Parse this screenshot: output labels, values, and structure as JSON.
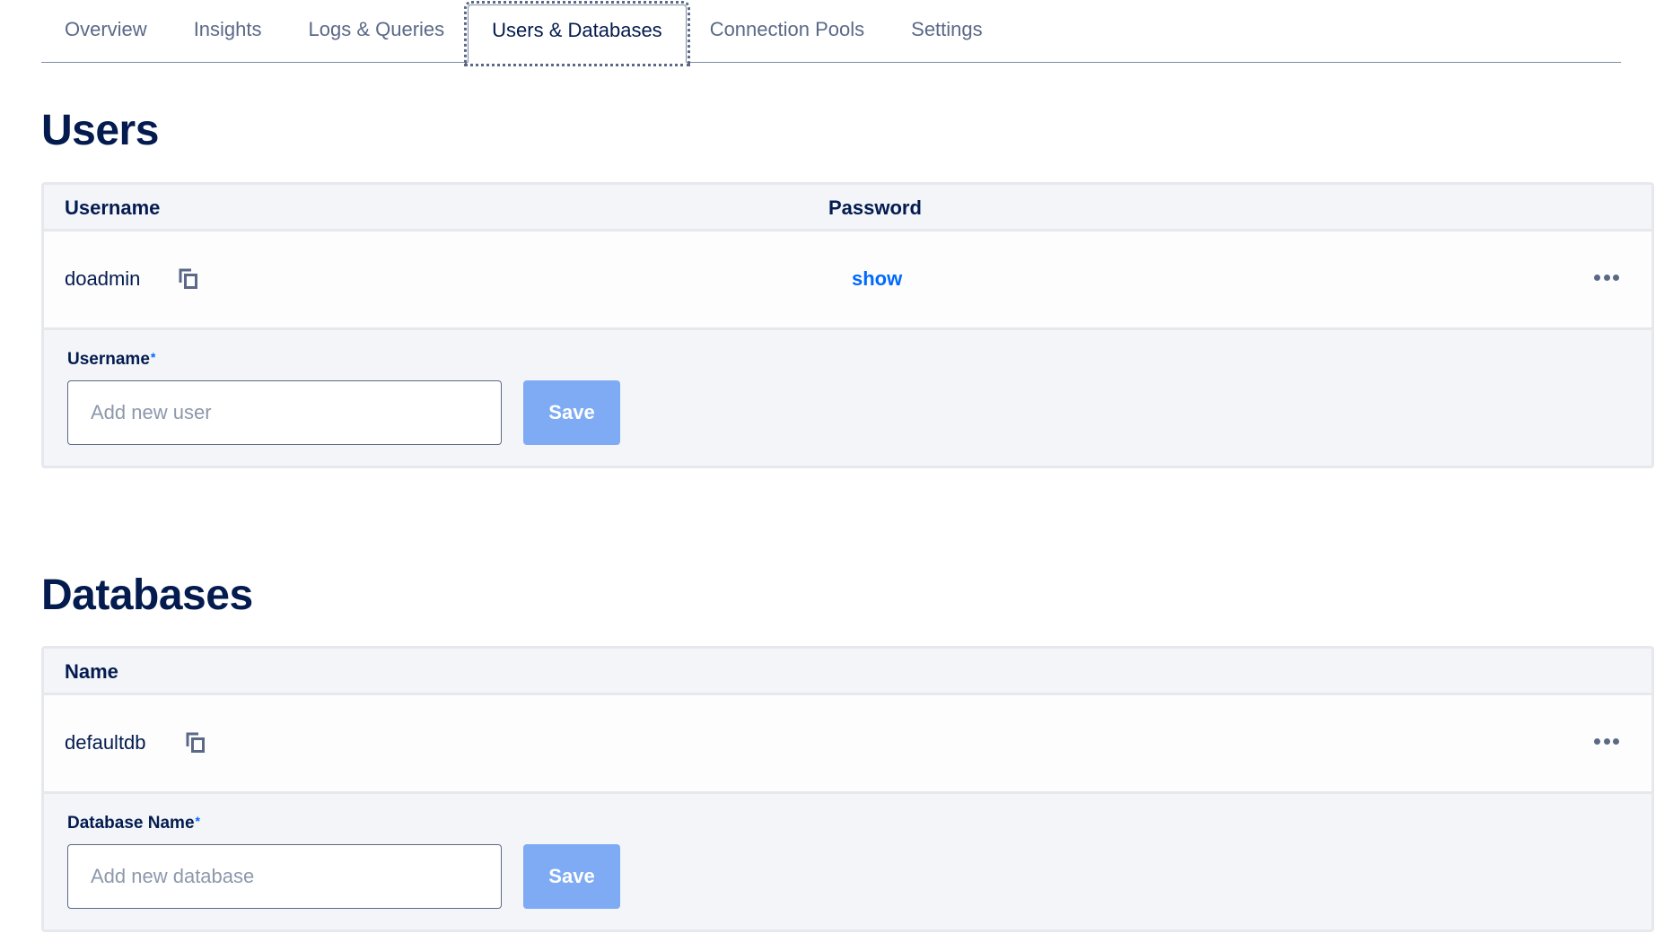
{
  "tabs": [
    {
      "label": "Overview",
      "active": false
    },
    {
      "label": "Insights",
      "active": false
    },
    {
      "label": "Logs & Queries",
      "active": false
    },
    {
      "label": "Users & Databases",
      "active": true
    },
    {
      "label": "Connection Pools",
      "active": false
    },
    {
      "label": "Settings",
      "active": false
    }
  ],
  "users": {
    "title": "Users",
    "columns": {
      "username": "Username",
      "password": "Password"
    },
    "rows": [
      {
        "username": "doadmin",
        "copy_icon": "copy-icon",
        "password_action": "show",
        "more_icon": "more-horizontal-icon"
      }
    ],
    "form": {
      "label": "Username",
      "required_marker": "*",
      "placeholder": "Add new user",
      "value": "",
      "save_label": "Save"
    }
  },
  "databases": {
    "title": "Databases",
    "columns": {
      "name": "Name"
    },
    "rows": [
      {
        "name": "defaultdb",
        "copy_icon": "copy-icon",
        "more_icon": "more-horizontal-icon"
      }
    ],
    "form": {
      "label": "Database Name",
      "required_marker": "*",
      "placeholder": "Add new database",
      "value": "",
      "save_label": "Save"
    }
  },
  "colors": {
    "primary_text": "#031b4e",
    "secondary_text": "#5b6987",
    "link": "#0069ff",
    "save_button_disabled": "#7eabf3",
    "card_background": "#f3f5f9",
    "card_border": "#e6e8ed"
  }
}
